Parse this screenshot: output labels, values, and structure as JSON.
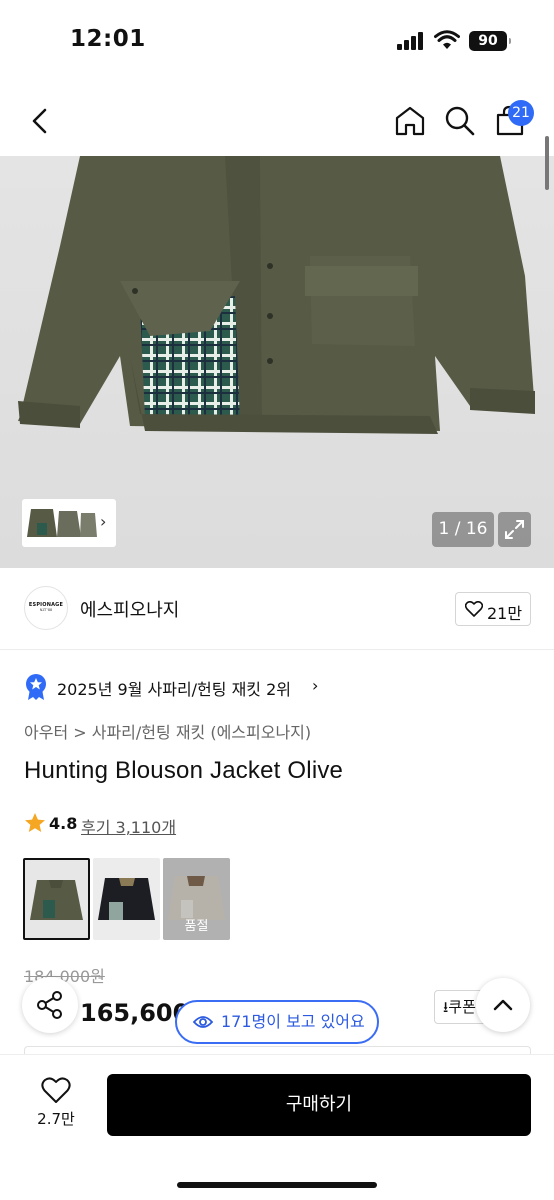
{
  "status_bar": {
    "time": "12:01",
    "battery": "90"
  },
  "header": {
    "cart_count": "21"
  },
  "gallery": {
    "counter": "1 / 16"
  },
  "brand": {
    "logo_line1": "ESPIONAGE",
    "logo_line2": "NZT'88",
    "name": "에스피오나지",
    "likes": "21만"
  },
  "ranking": {
    "text": "2025년 9월 사파리/헌팅 재킷 2위"
  },
  "breadcrumb": "아우터 > 사파리/헌팅 재킷 (에스피오나지)",
  "product": {
    "title": "Hunting Blouson Jacket Olive",
    "rating": "4.8",
    "reviews": "후기 3,110개",
    "colors": [
      {
        "name": "Olive",
        "selected": true,
        "soldout": ""
      },
      {
        "name": "Black",
        "selected": false,
        "soldout": ""
      },
      {
        "name": "Beige",
        "selected": false,
        "soldout": "품절"
      }
    ],
    "original_price": "184,000원",
    "sale_price": "165,600원",
    "coupon_label": "쿠폰"
  },
  "viewers": "171명이 보고 있어요",
  "bottom_bar": {
    "wish_count": "2.7만",
    "buy_label": "구매하기"
  },
  "colors": {
    "accent_blue": "#2f6bf6",
    "badge_blue": "#3a6cf4",
    "star": "#f5a623",
    "buy_bg": "#000000"
  }
}
